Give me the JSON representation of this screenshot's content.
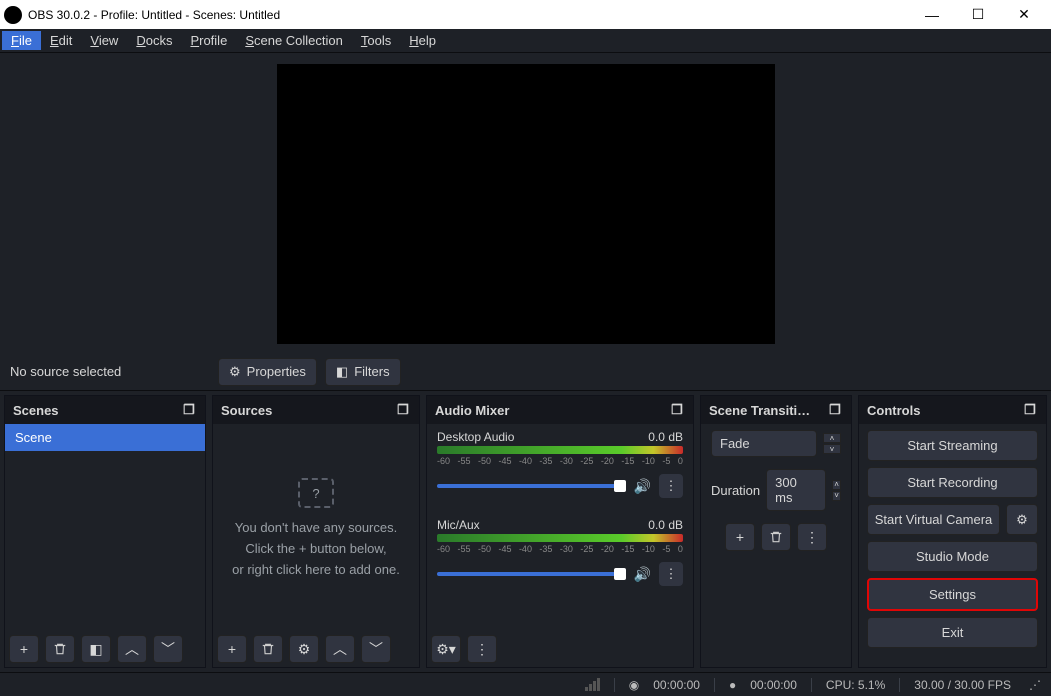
{
  "window": {
    "title": "OBS 30.0.2 - Profile: Untitled - Scenes: Untitled"
  },
  "menu": [
    "File",
    "Edit",
    "View",
    "Docks",
    "Profile",
    "Scene Collection",
    "Tools",
    "Help"
  ],
  "toolbar": {
    "nosource": "No source selected",
    "properties": "Properties",
    "filters": "Filters"
  },
  "docks": {
    "scenes": {
      "title": "Scenes",
      "items": [
        "Scene"
      ]
    },
    "sources": {
      "title": "Sources",
      "empty1": "You don't have any sources.",
      "empty2": "Click the + button below,",
      "empty3": "or right click here to add one."
    },
    "mixer": {
      "title": "Audio Mixer",
      "channels": [
        {
          "name": "Desktop Audio",
          "db": "0.0 dB"
        },
        {
          "name": "Mic/Aux",
          "db": "0.0 dB"
        }
      ],
      "ticks": [
        "-60",
        "-55",
        "-50",
        "-45",
        "-40",
        "-35",
        "-30",
        "-25",
        "-20",
        "-15",
        "-10",
        "-5",
        "0"
      ]
    },
    "transitions": {
      "title": "Scene Transiti…",
      "selected": "Fade",
      "duration_label": "Duration",
      "duration_value": "300 ms"
    },
    "controls": {
      "title": "Controls",
      "buttons": {
        "stream": "Start Streaming",
        "record": "Start Recording",
        "vcam": "Start Virtual Camera",
        "studio": "Studio Mode",
        "settings": "Settings",
        "exit": "Exit"
      }
    }
  },
  "status": {
    "time1": "00:00:00",
    "time2": "00:00:00",
    "cpu": "CPU: 5.1%",
    "fps": "30.00 / 30.00 FPS"
  }
}
